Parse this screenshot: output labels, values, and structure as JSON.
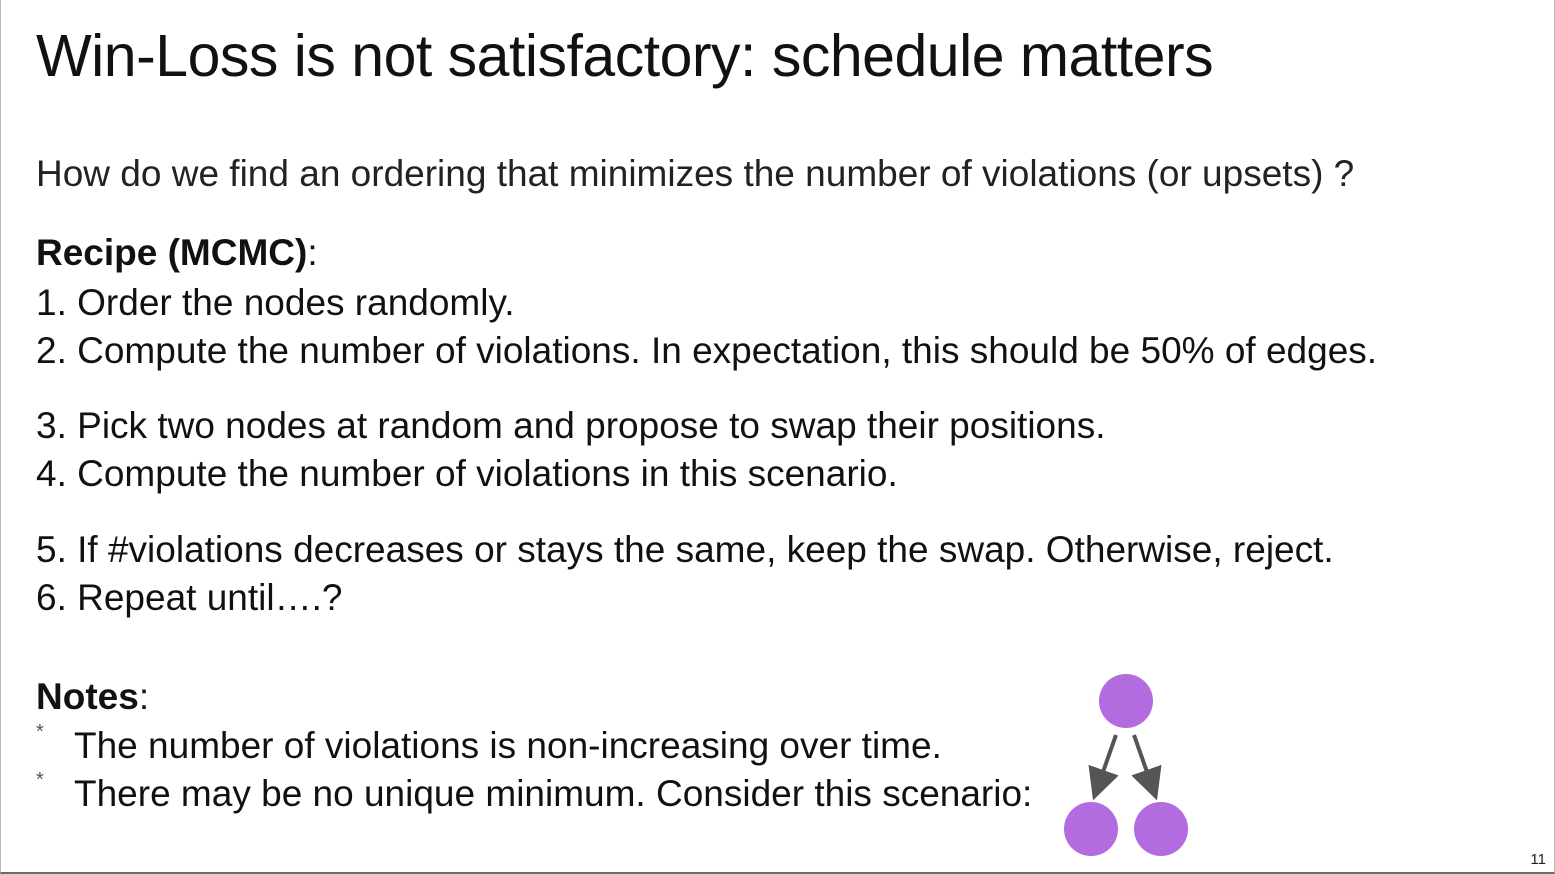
{
  "slide": {
    "title": "Win-Loss is not satisfactory: schedule matters",
    "question": "How do we find an ordering that minimizes the number of violations (or upsets) ?",
    "recipe_heading": "Recipe (MCMC)",
    "recipe_colon": ":",
    "steps": [
      "1. Order the nodes randomly.",
      "2. Compute the number of violations. In expectation, this should be 50% of edges.",
      "3. Pick two nodes at random and propose to swap their positions.",
      "4. Compute the number of violations in this scenario.",
      "5. If #violations decreases or stays the same, keep the swap. Otherwise, reject.",
      "6. Repeat until….?"
    ],
    "notes_heading": "Notes",
    "notes_colon": ":",
    "bullet_mark": "*",
    "notes": [
      "The number of violations is non-increasing over time.",
      "There may be no unique minimum. Consider this scenario:"
    ],
    "page_number": "11"
  },
  "diagram": {
    "node_color": "#b36ce0",
    "edge_color": "#555555"
  }
}
